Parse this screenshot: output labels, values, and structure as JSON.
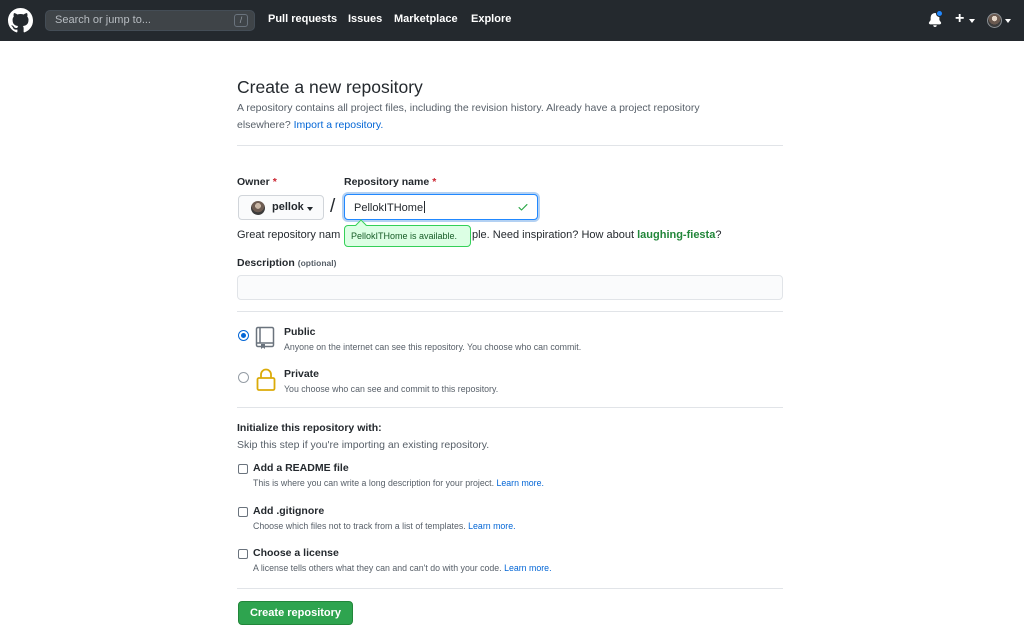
{
  "header": {
    "search_placeholder": "Search or jump to...",
    "search_key": "/",
    "nav": [
      "Pull requests",
      "Issues",
      "Marketplace",
      "Explore"
    ],
    "plus": "+"
  },
  "page": {
    "title": "Create a new repository",
    "intro_line1": "A repository contains all project files, including the revision history. Already have a project repository",
    "intro_line2_prefix": "elsewhere? ",
    "import_link": "Import a repository."
  },
  "form": {
    "owner_label": "Owner",
    "owner_value": "pellok",
    "separator": "/",
    "repo_label": "Repository name",
    "required_mark": "*",
    "repo_value": "PellokITHome",
    "availability": "PellokITHome is available.",
    "hint_prefix": "Great repository nam",
    "hint_middle": "ple. Need inspiration? How about ",
    "hint_suggestion": "laughing-fiesta",
    "hint_suffix": "?",
    "description_label": "Description",
    "description_optional": "(optional)",
    "description_value": ""
  },
  "visibility": {
    "selected": "public",
    "public_title": "Public",
    "public_desc": "Anyone on the internet can see this repository. You choose who can commit.",
    "private_title": "Private",
    "private_desc": "You choose who can see and commit to this repository."
  },
  "init": {
    "title": "Initialize this repository with:",
    "subtitle": "Skip this step if you're importing an existing repository.",
    "learn_more": "Learn more.",
    "readme_title": "Add a README file",
    "readme_desc": "This is where you can write a long description for your project.",
    "gitignore_title": "Add .gitignore",
    "gitignore_desc": "Choose which files not to track from a list of templates.",
    "license_title": "Choose a license",
    "license_desc": "A license tells others what they can and can't do with your code."
  },
  "submit_label": "Create repository",
  "colors": {
    "header_bg": "#24292e",
    "link": "#0366d6",
    "primary_button": "#2ea44f",
    "success_green": "#28a745",
    "required_red": "#cb2431"
  }
}
